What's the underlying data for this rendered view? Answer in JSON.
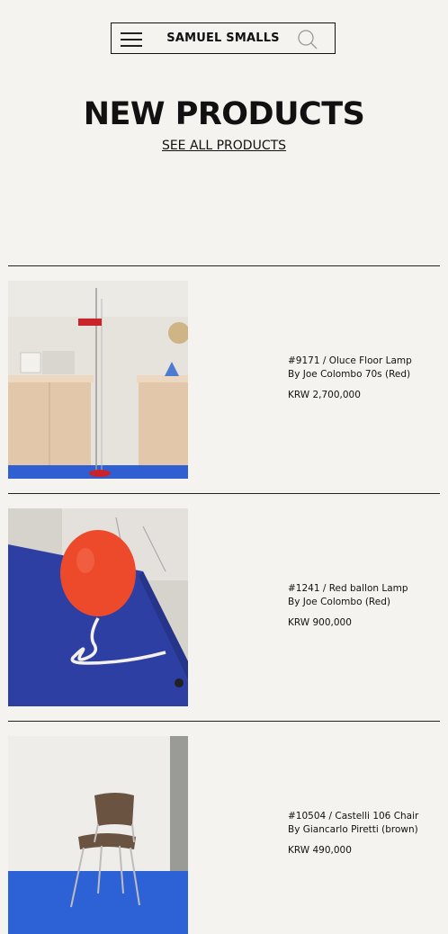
{
  "header": {
    "brand": "SAMUEL SMALLS",
    "menu_icon": "hamburger-menu-icon",
    "search_icon": "search-icon"
  },
  "section": {
    "title": "NEW PRODUCTS",
    "see_all": "SEE ALL PRODUCTS"
  },
  "products": [
    {
      "name": "#9171 / Oluce Floor Lamp\nBy Joe Colombo 70s (Red)",
      "price": "KRW 2,700,000",
      "image": "floor-lamp-photo"
    },
    {
      "name": "#1241 / Red ballon Lamp\nBy Joe Colombo (Red)",
      "price": "KRW 900,000",
      "image": "balloon-lamp-photo"
    },
    {
      "name": "#10504 / Castelli 106 Chair\nBy Giancarlo Piretti (brown)",
      "price": "KRW 490,000",
      "image": "chair-photo"
    }
  ],
  "colors": {
    "background": "#f5f3ef",
    "text": "#111111",
    "floor_blue": "#2f5fd0"
  }
}
